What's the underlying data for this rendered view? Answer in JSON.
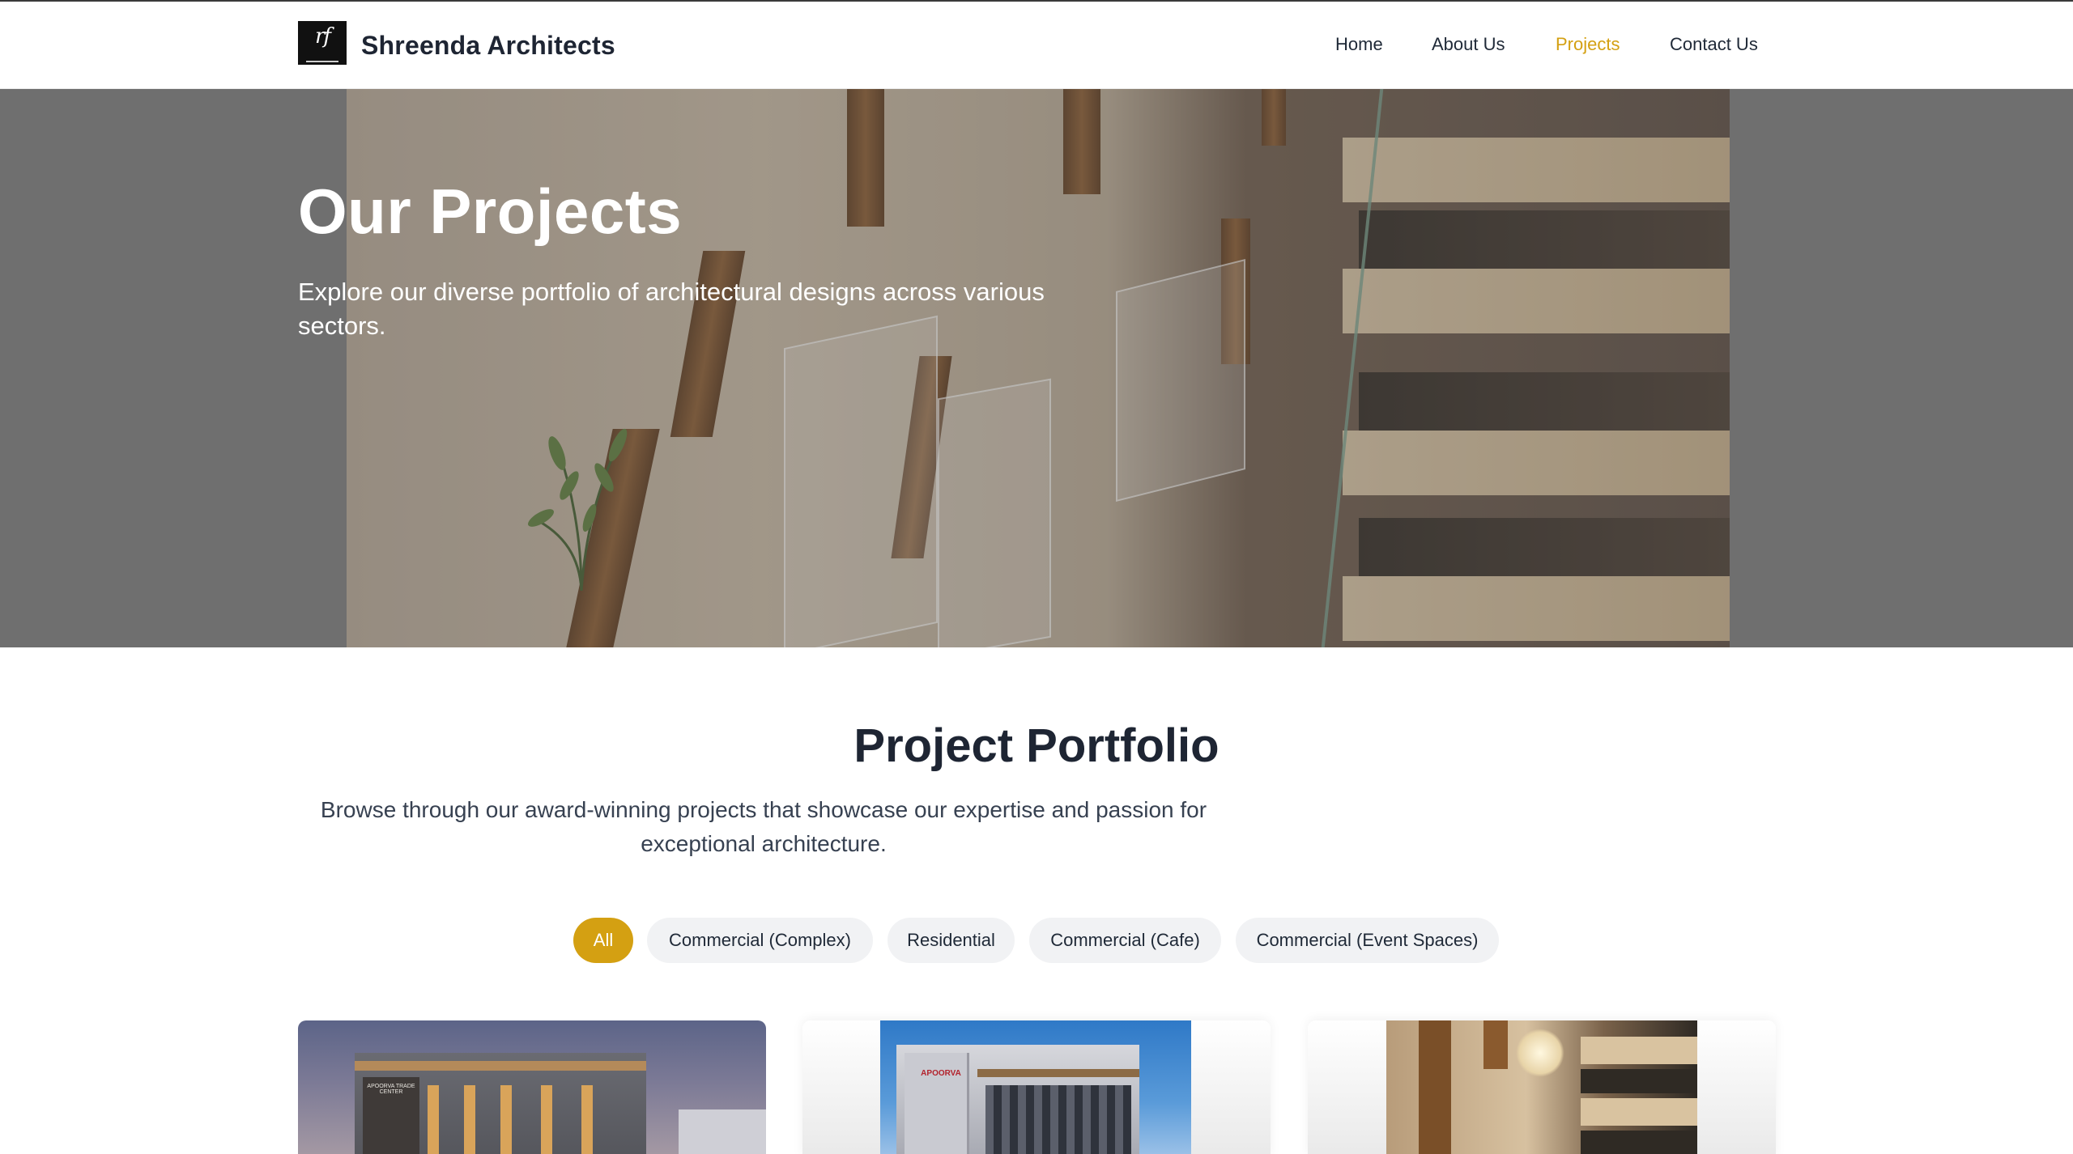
{
  "brand": {
    "name": "Shreenda Architects",
    "logo_mark": "rf"
  },
  "nav": {
    "items": [
      {
        "label": "Home"
      },
      {
        "label": "About Us"
      },
      {
        "label": "Projects",
        "active": true
      },
      {
        "label": "Contact Us"
      }
    ]
  },
  "hero": {
    "title": "Our Projects",
    "subtitle": "Explore our diverse portfolio of architectural designs across various sectors."
  },
  "portfolio": {
    "title": "Project Portfolio",
    "subtitle": "Browse through our award-winning projects that showcase our expertise and passion for exceptional architecture.",
    "filters": [
      {
        "label": "All",
        "active": true
      },
      {
        "label": "Commercial (Complex)"
      },
      {
        "label": "Residential"
      },
      {
        "label": "Commercial (Cafe)"
      },
      {
        "label": "Commercial (Event Spaces)"
      }
    ],
    "cards": [
      {
        "image": "building-facade-dusk",
        "sign": "APOORVA TRADE CENTER"
      },
      {
        "image": "building-facade-blue-sky",
        "sign": "APOORVA"
      },
      {
        "image": "staircase-interior"
      }
    ]
  },
  "colors": {
    "accent": "#d4a012",
    "heading": "#1e2533",
    "chip_bg": "#f1f2f4"
  }
}
